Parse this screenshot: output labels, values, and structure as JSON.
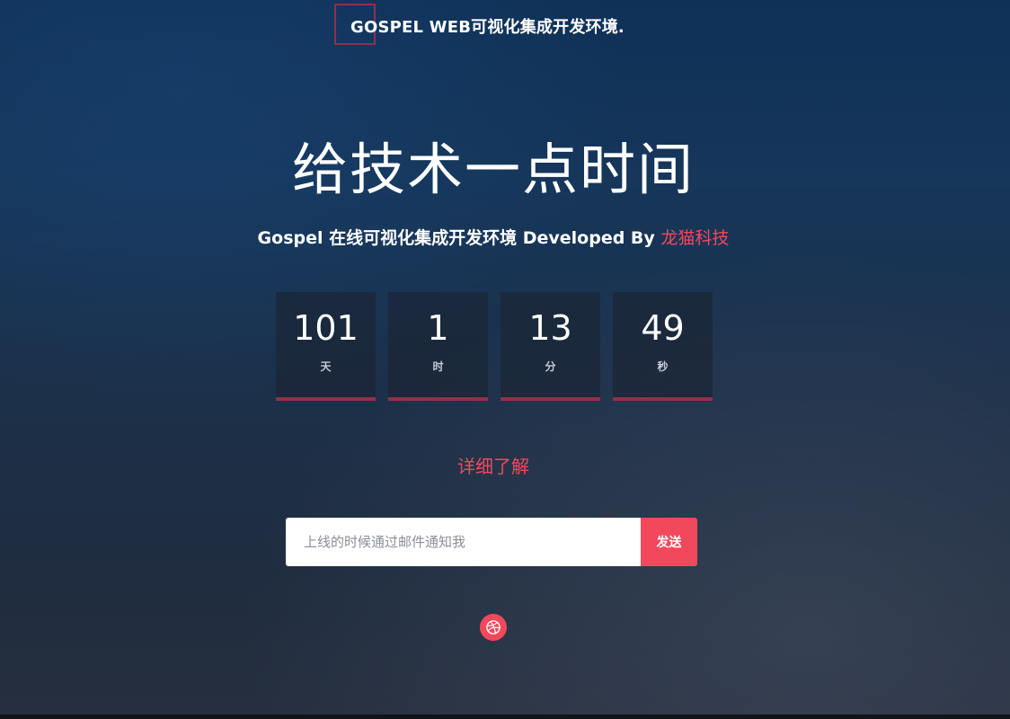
{
  "header": {
    "logo_text": "GOSPEL WEB可视化集成开发环境."
  },
  "hero": {
    "title": "给技术一点时间",
    "subtitle_prefix": "Gospel 在线可视化集成开发环境 Developed By ",
    "subtitle_brand": "龙猫科技"
  },
  "countdown": [
    {
      "value": "101",
      "label": "天"
    },
    {
      "value": "1",
      "label": "时"
    },
    {
      "value": "13",
      "label": "分"
    },
    {
      "value": "49",
      "label": "秒"
    }
  ],
  "learn_more": "详细了解",
  "subscribe": {
    "placeholder": "上线的时候通过邮件通知我",
    "button_label": "发送"
  },
  "social": {
    "icon": "dribbble-icon"
  },
  "colors": {
    "accent": "#f2485c",
    "box_border": "#8c3446"
  }
}
